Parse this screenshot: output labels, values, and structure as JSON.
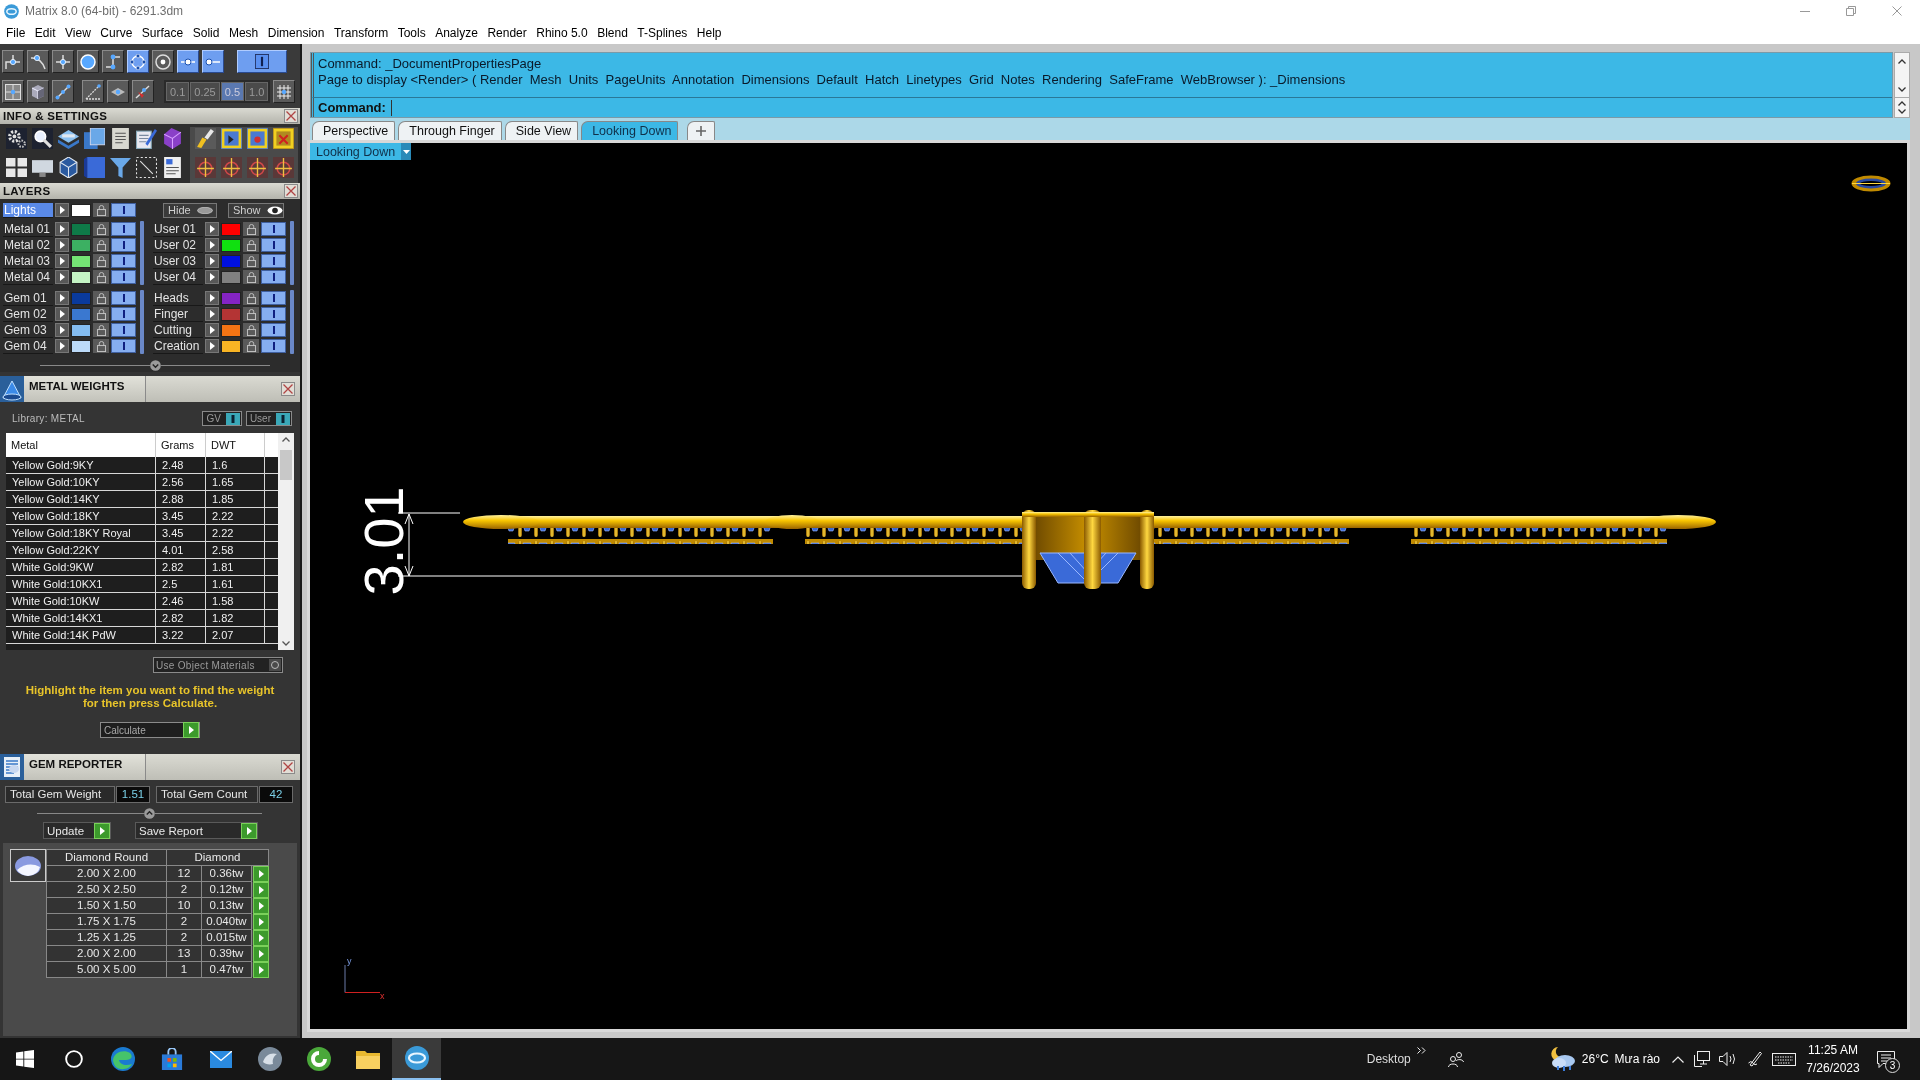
{
  "window": {
    "title": "Matrix 8.0 (64-bit) - 6291.3dm"
  },
  "menu": [
    "File",
    "Edit",
    "View",
    "Curve",
    "Surface",
    "Solid",
    "Mesh",
    "Dimension",
    "Transform",
    "Tools",
    "Analyze",
    "Render",
    "Rhino 5.0",
    "Blend",
    "T-Splines",
    "Help"
  ],
  "snaps": {
    "toggles": [
      {
        "on": false
      },
      {
        "on": false
      },
      {
        "on": false
      },
      {
        "on": false
      },
      {
        "on": false
      },
      {
        "on": true
      },
      {
        "on": false
      },
      {
        "on": true
      },
      {
        "on": true
      },
      {
        "on": true
      }
    ],
    "increments": [
      {
        "label": "0.1",
        "selected": false
      },
      {
        "label": "0.25",
        "selected": false
      },
      {
        "label": "0.5",
        "selected": true
      },
      {
        "label": "1.0",
        "selected": false
      }
    ]
  },
  "info_settings": {
    "title": "INFO & SETTINGS"
  },
  "layers": {
    "title": "LAYERS",
    "lights": {
      "name": "Lights",
      "color": "#ffffff",
      "selected": true,
      "visible": true
    },
    "hide_button": "Hide",
    "show_button": "Show",
    "groups": [
      {
        "items": [
          {
            "name": "Metal 01",
            "color": "#0e7a48",
            "selected": false,
            "visible": true
          },
          {
            "name": "Metal 02",
            "color": "#3cb062",
            "selected": false,
            "visible": true
          },
          {
            "name": "Metal 03",
            "color": "#74e474",
            "selected": false,
            "visible": true
          },
          {
            "name": "Metal 04",
            "color": "#c4f4c4",
            "selected": false,
            "visible": true
          }
        ]
      },
      {
        "items": [
          {
            "name": "User 01",
            "color": "#ff0000",
            "selected": false,
            "visible": true
          },
          {
            "name": "User 02",
            "color": "#10e010",
            "selected": false,
            "visible": true
          },
          {
            "name": "User 03",
            "color": "#0010e0",
            "selected": false,
            "visible": true
          },
          {
            "name": "User 04",
            "color": "#808080",
            "selected": false,
            "visible": true
          }
        ]
      },
      {
        "items": [
          {
            "name": "Gem 01",
            "color": "#0a3a9c",
            "selected": false,
            "visible": true
          },
          {
            "name": "Gem 02",
            "color": "#3a78d0",
            "selected": false,
            "visible": true
          },
          {
            "name": "Gem 03",
            "color": "#84bcf0",
            "selected": false,
            "visible": true
          },
          {
            "name": "Gem 04",
            "color": "#bcdaf8",
            "selected": false,
            "visible": true
          }
        ]
      },
      {
        "items": [
          {
            "name": "Heads",
            "color": "#8424c4",
            "selected": false,
            "visible": true
          },
          {
            "name": "Finger",
            "color": "#b43434",
            "selected": false,
            "visible": true
          },
          {
            "name": "Cutting",
            "color": "#f47414",
            "selected": false,
            "visible": true
          },
          {
            "name": "Creation",
            "color": "#f8b424",
            "selected": false,
            "visible": true
          }
        ]
      }
    ]
  },
  "metal_weights": {
    "title": "METAL WEIGHTS",
    "library": "Library: METAL",
    "toggles": [
      {
        "label": "GV",
        "on": true
      },
      {
        "label": "User",
        "on": true
      }
    ],
    "table": {
      "columns": [
        "Metal",
        "Grams",
        "DWT"
      ],
      "rows": [
        [
          "Yellow Gold:9KY",
          "2.48",
          "1.6"
        ],
        [
          "Yellow Gold:10KY",
          "2.56",
          "1.65"
        ],
        [
          "Yellow Gold:14KY",
          "2.88",
          "1.85"
        ],
        [
          "Yellow Gold:18KY",
          "3.45",
          "2.22"
        ],
        [
          "Yellow Gold:18KY Royal",
          "3.45",
          "2.22"
        ],
        [
          "Yellow Gold:22KY",
          "4.01",
          "2.58"
        ],
        [
          "White Gold:9KW",
          "2.82",
          "1.81"
        ],
        [
          "White Gold:10KX1",
          "2.5",
          "1.61"
        ],
        [
          "White Gold:10KW",
          "2.46",
          "1.58"
        ],
        [
          "White Gold:14KX1",
          "2.82",
          "1.82"
        ],
        [
          "White Gold:14K PdW",
          "3.22",
          "2.07"
        ]
      ]
    },
    "use_object_materials": {
      "label": "Use Object Materials",
      "on": false
    },
    "hint": "Highlight the item you want to find the weight for then press Calculate.",
    "calculate_button": "Calculate"
  },
  "gem_reporter": {
    "title": "GEM REPORTER",
    "total_weight_label": "Total Gem Weight",
    "total_weight": "1.51",
    "total_count_label": "Total Gem Count",
    "total_count": "42",
    "update_button": "Update",
    "save_button": "Save Report",
    "table": {
      "columns": [
        "Diamond Round",
        "Diamond"
      ],
      "rows": [
        {
          "size": "2.00 X 2.00",
          "count": "12",
          "weight": "0.36tw"
        },
        {
          "size": "2.50 X 2.50",
          "count": "2",
          "weight": "0.12tw"
        },
        {
          "size": "1.50 X 1.50",
          "count": "10",
          "weight": "0.13tw"
        },
        {
          "size": "1.75 X 1.75",
          "count": "2",
          "weight": "0.040tw"
        },
        {
          "size": "1.25 X 1.25",
          "count": "2",
          "weight": "0.015tw"
        },
        {
          "size": "2.00 X 2.00",
          "count": "13",
          "weight": "0.39tw"
        },
        {
          "size": "5.00 X 5.00",
          "count": "1",
          "weight": "0.47tw"
        }
      ]
    }
  },
  "command": {
    "history": [
      "Command: _DocumentPropertiesPage",
      "Page to display <Render> ( Render  Mesh  Units  PageUnits  Annotation  Dimensions  Default  Hatch  Linetypes  Grid  Notes  Rendering  SafeFrame  WebBrowser ): _Dimensions"
    ],
    "prompt": "Command:"
  },
  "viewports": {
    "tabs": [
      {
        "label": "Perspective",
        "selected": false
      },
      {
        "label": "Through Finger",
        "selected": false
      },
      {
        "label": "Side View",
        "selected": false
      },
      {
        "label": "Looking Down",
        "selected": true
      }
    ],
    "active_view": "Looking Down",
    "dimension": "3.01",
    "axis_labels": {
      "y": "y",
      "x": "x"
    }
  },
  "taskbar": {
    "apps": [
      {
        "selected": false
      },
      {
        "selected": false
      },
      {
        "selected": false
      },
      {
        "selected": false
      },
      {
        "selected": false
      },
      {
        "selected": false
      },
      {
        "selected": false
      },
      {
        "selected": true
      }
    ],
    "toolbar": "Desktop",
    "weather": {
      "temperature": "26°C",
      "condition": "Mưa rào"
    },
    "clock": {
      "time": "11:25 AM",
      "date": "7/26/2023"
    },
    "notification_count": "3"
  }
}
